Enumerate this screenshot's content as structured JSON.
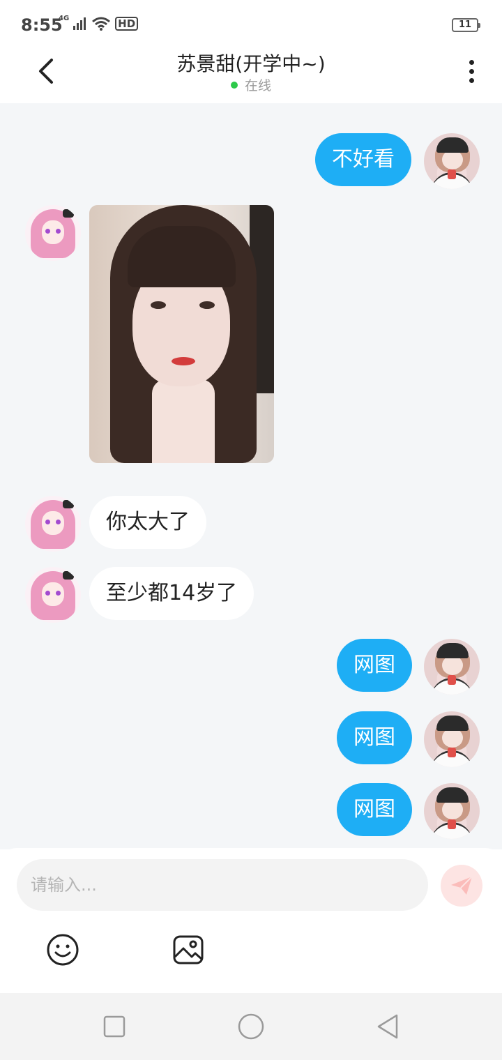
{
  "status_bar": {
    "time": "8:55",
    "network": "4G",
    "hd": "HD",
    "battery": "11"
  },
  "header": {
    "title": "苏景甜(开学中~)",
    "status": "在线"
  },
  "messages": [
    {
      "sender": "self",
      "type": "text",
      "text": "不好看"
    },
    {
      "sender": "other",
      "type": "image"
    },
    {
      "sender": "other",
      "type": "text",
      "text": "你太大了"
    },
    {
      "sender": "other",
      "type": "text",
      "text": "至少都14岁了"
    },
    {
      "sender": "self",
      "type": "text",
      "text": "网图"
    },
    {
      "sender": "self",
      "type": "text",
      "text": "网图"
    },
    {
      "sender": "self",
      "type": "text",
      "text": "网图"
    }
  ],
  "composer": {
    "placeholder": "请输入..."
  },
  "icons": {
    "back": "chevron-left-icon",
    "more": "more-vertical-icon",
    "send": "paper-plane-icon",
    "emoji": "smiley-icon",
    "image": "image-icon",
    "nav": [
      "square-icon",
      "circle-icon",
      "triangle-back-icon"
    ]
  },
  "colors": {
    "self_bubble": "#1eaef5",
    "online": "#2dc94a",
    "chat_bg": "#f4f6f8",
    "send_bg": "#fde4e3"
  }
}
